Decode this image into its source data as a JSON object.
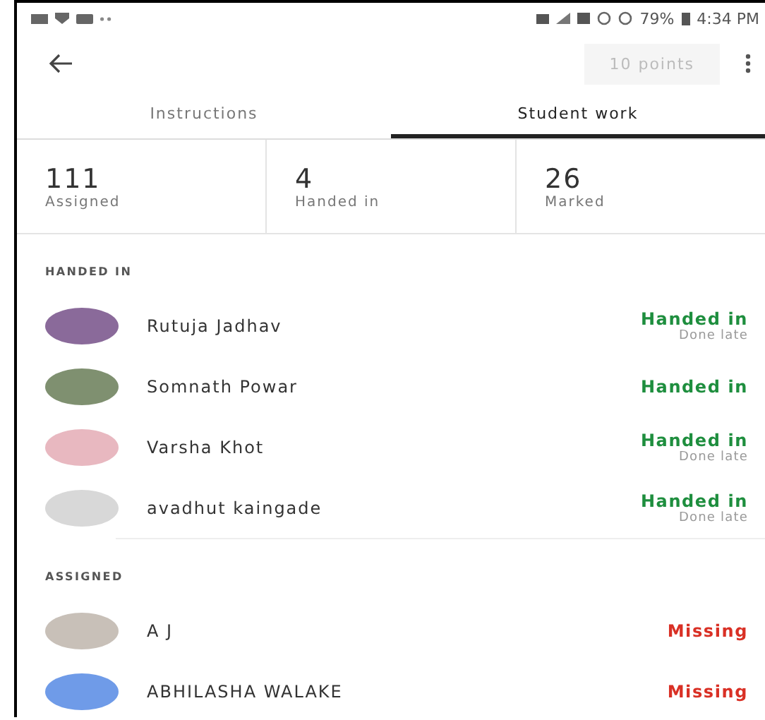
{
  "status_bar": {
    "battery": "79%",
    "time": "4:34 PM"
  },
  "toolbar": {
    "points_button": {
      "label": "10 points",
      "disabled": true
    }
  },
  "tabs": [
    {
      "label": "Instructions",
      "selected": false
    },
    {
      "label": "Student work",
      "selected": true
    }
  ],
  "stats": [
    {
      "value": "111",
      "label": "Assigned"
    },
    {
      "value": "4",
      "label": "Handed in"
    },
    {
      "value": "26",
      "label": "Marked"
    }
  ],
  "sections": [
    {
      "title": "HANDED IN",
      "students": [
        {
          "name": "Rutuja Jadhav",
          "status": "Handed in",
          "kind": "handed_in",
          "note": "Done late"
        },
        {
          "name": "Somnath Powar",
          "status": "Handed in",
          "kind": "handed_in"
        },
        {
          "name": "Varsha Khot",
          "status": "Handed in",
          "kind": "handed_in",
          "note": "Done late"
        },
        {
          "name": "avadhut kaingade",
          "status": "Handed in",
          "kind": "handed_in",
          "note": "Done late"
        }
      ]
    },
    {
      "title": "ASSIGNED",
      "students": [
        {
          "name": "A J",
          "status": "Missing",
          "kind": "missing"
        },
        {
          "name": "ABHILASHA WALAKE",
          "status": "Missing",
          "kind": "missing"
        }
      ]
    }
  ]
}
